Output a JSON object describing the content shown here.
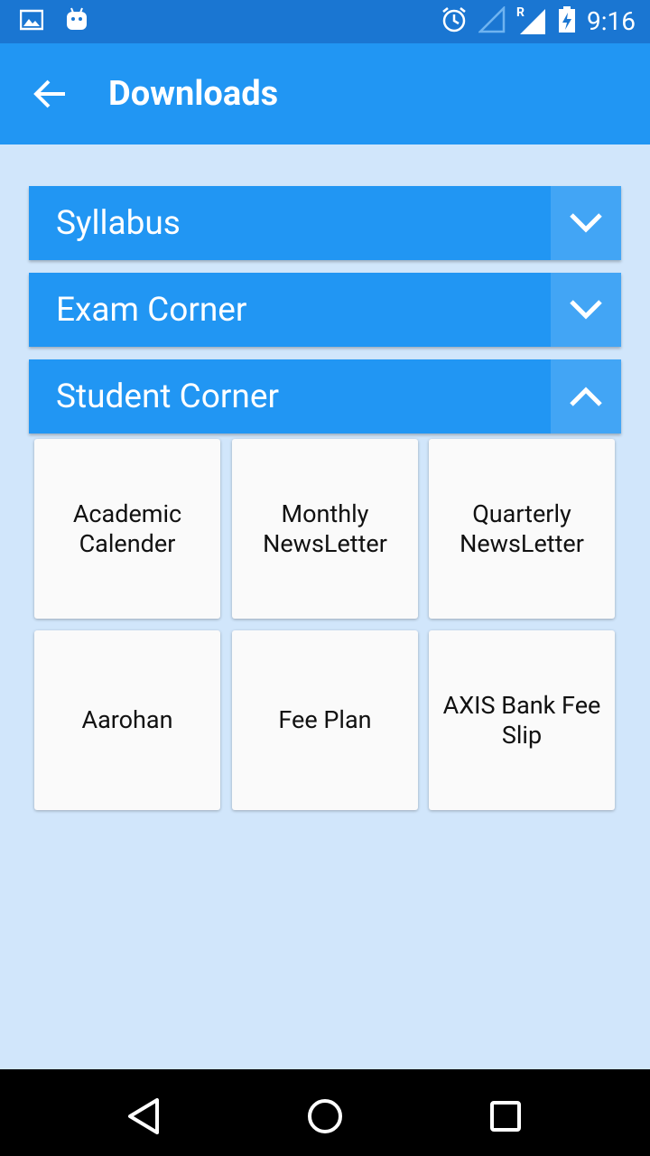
{
  "status_bar": {
    "time": "9:16",
    "left_icons": [
      "image-notification-icon",
      "android-notification-icon"
    ],
    "right_icons": [
      "alarm-icon",
      "wifi-signal-icon",
      "cell-signal-roaming-icon",
      "battery-charging-icon"
    ],
    "roaming_indicator": "R"
  },
  "app_bar": {
    "title": "Downloads",
    "back_icon": "back-arrow-icon"
  },
  "sections": [
    {
      "label": "Syllabus",
      "expanded": false,
      "toggle_icon": "chevron-down-icon"
    },
    {
      "label": "Exam Corner",
      "expanded": false,
      "toggle_icon": "chevron-down-icon"
    },
    {
      "label": "Student Corner",
      "expanded": true,
      "toggle_icon": "chevron-up-icon"
    }
  ],
  "student_corner_items": [
    [
      "Academic",
      "Calender"
    ],
    [
      "Monthly",
      "NewsLetter"
    ],
    [
      "Quarterly",
      "NewsLetter"
    ],
    [
      "Aarohan"
    ],
    [
      "Fee Plan"
    ],
    [
      "AXIS Bank Fee",
      "Slip"
    ]
  ],
  "colors": {
    "status_bar": "#1a76d2",
    "app_bar": "#2196f3",
    "section_header": "#2196f3",
    "section_toggle": "#42a5f5",
    "background": "#d1e6fb",
    "tile": "#fafafa",
    "nav_bar": "#000000"
  },
  "nav_bar": {
    "buttons": [
      "back-triangle-icon",
      "home-circle-icon",
      "recents-square-icon"
    ]
  }
}
